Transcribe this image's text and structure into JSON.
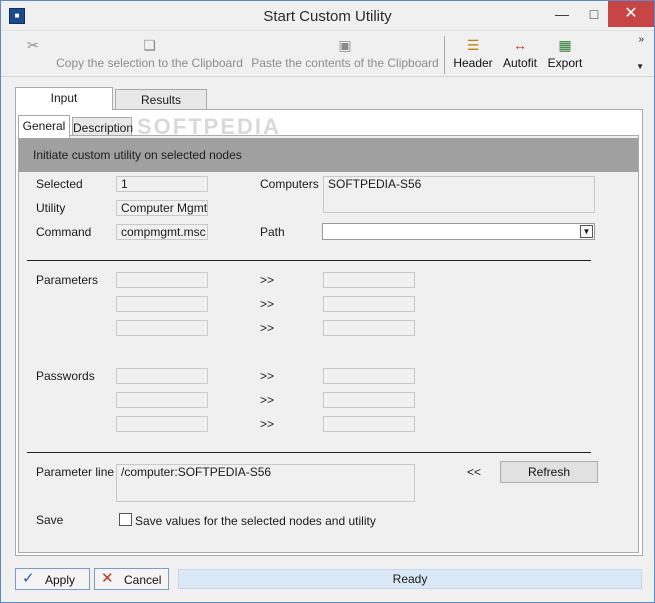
{
  "window": {
    "title": "Start Custom Utility",
    "icon": "app-icon"
  },
  "toolbar": {
    "copy_label": "Copy the selection to the Clipboard",
    "paste_label": "Paste the contents of the Clipboard",
    "header_label": "Header",
    "autofit_label": "Autofit",
    "export_label": "Export"
  },
  "tabs": {
    "input": "Input",
    "results": "Results"
  },
  "subtabs": {
    "general": "General",
    "description": "Description"
  },
  "banner": "Initiate custom utility on selected nodes",
  "fields": {
    "selected_label": "Selected",
    "selected_value": "1",
    "utility_label": "Utility",
    "utility_value": "Computer Mgmt",
    "command_label": "Command",
    "command_value": "compmgmt.msc",
    "computers_label": "Computers",
    "computers_value": "SOFTPEDIA-S56",
    "path_label": "Path",
    "path_value": ""
  },
  "parameters": {
    "label": "Parameters",
    "rows": [
      {
        "arrow": ">>"
      },
      {
        "arrow": ">>"
      },
      {
        "arrow": ">>"
      }
    ]
  },
  "passwords": {
    "label": "Passwords",
    "rows": [
      {
        "arrow": ">>"
      },
      {
        "arrow": ">>"
      },
      {
        "arrow": ">>"
      }
    ]
  },
  "parameter_line": {
    "label": "Parameter line",
    "value": "/computer:SOFTPEDIA-S56",
    "arrow": "<<",
    "refresh_label": "Refresh"
  },
  "save": {
    "label": "Save",
    "checkbox_label": "Save values for the selected nodes and utility",
    "checked": false
  },
  "bottom": {
    "apply_label": "Apply",
    "cancel_label": "Cancel",
    "status": "Ready"
  }
}
